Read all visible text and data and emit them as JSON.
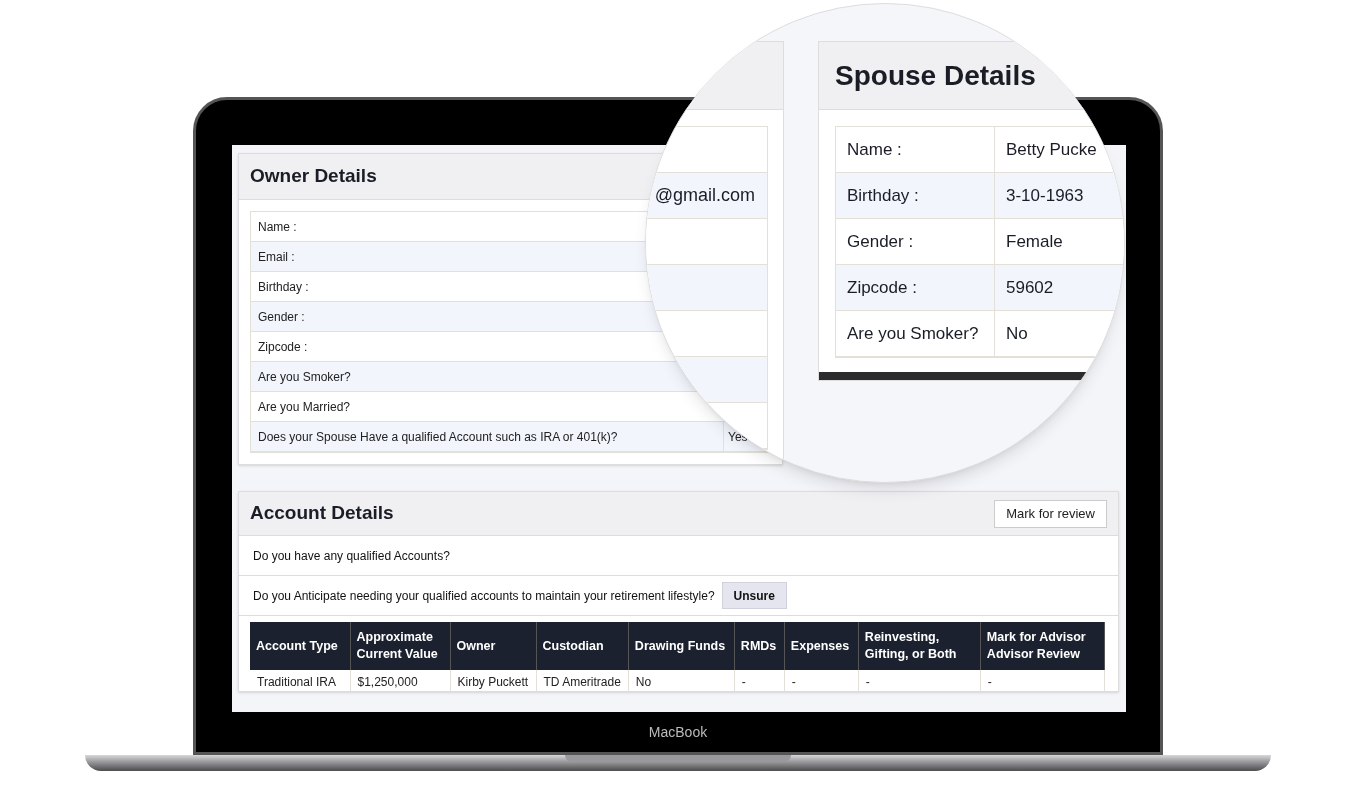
{
  "owner_details": {
    "title": "Owner Details",
    "rows": [
      {
        "label": "Name :"
      },
      {
        "label": "Email :"
      },
      {
        "label": "Birthday :"
      },
      {
        "label": "Gender :"
      },
      {
        "label": "Zipcode :"
      },
      {
        "label": "Are you Smoker?"
      },
      {
        "label": "Are you Married?"
      },
      {
        "label": "Does your Spouse Have a qualified Account such as IRA or 401(k)?",
        "value": "Yes"
      }
    ]
  },
  "magnifier": {
    "owner_email_value": "@gmail.com",
    "spouse_details": {
      "title": "Spouse Details",
      "rows": [
        {
          "label": "Name :",
          "value": "Betty Pucke"
        },
        {
          "label": "Birthday :",
          "value": "3-10-1963"
        },
        {
          "label": "Gender :",
          "value": "Female"
        },
        {
          "label": "Zipcode :",
          "value": "59602"
        },
        {
          "label": "Are you Smoker?",
          "value": "No"
        }
      ]
    }
  },
  "account_details": {
    "title": "Account Details",
    "review_button": "Mark for review",
    "questions": [
      {
        "text": "Do you have any qualified Accounts?"
      },
      {
        "text": "Do you Anticipate needing your qualified accounts to maintain your retirement lifestyle?",
        "answer": "Unsure"
      }
    ],
    "table": {
      "columns": [
        "Account Type",
        "Approximate Current Value",
        "Owner",
        "Custodian",
        "Drawing Funds",
        "RMDs",
        "Expenses",
        "Reinvesting, Gifting, or Both",
        "Mark for Advisor Advisor Review"
      ],
      "rows": [
        [
          "Traditional IRA",
          "$1,250,000",
          "Kirby Puckett",
          "TD Ameritrade",
          "No",
          "-",
          "-",
          "-",
          "-"
        ]
      ]
    }
  },
  "device_label": "MacBook"
}
